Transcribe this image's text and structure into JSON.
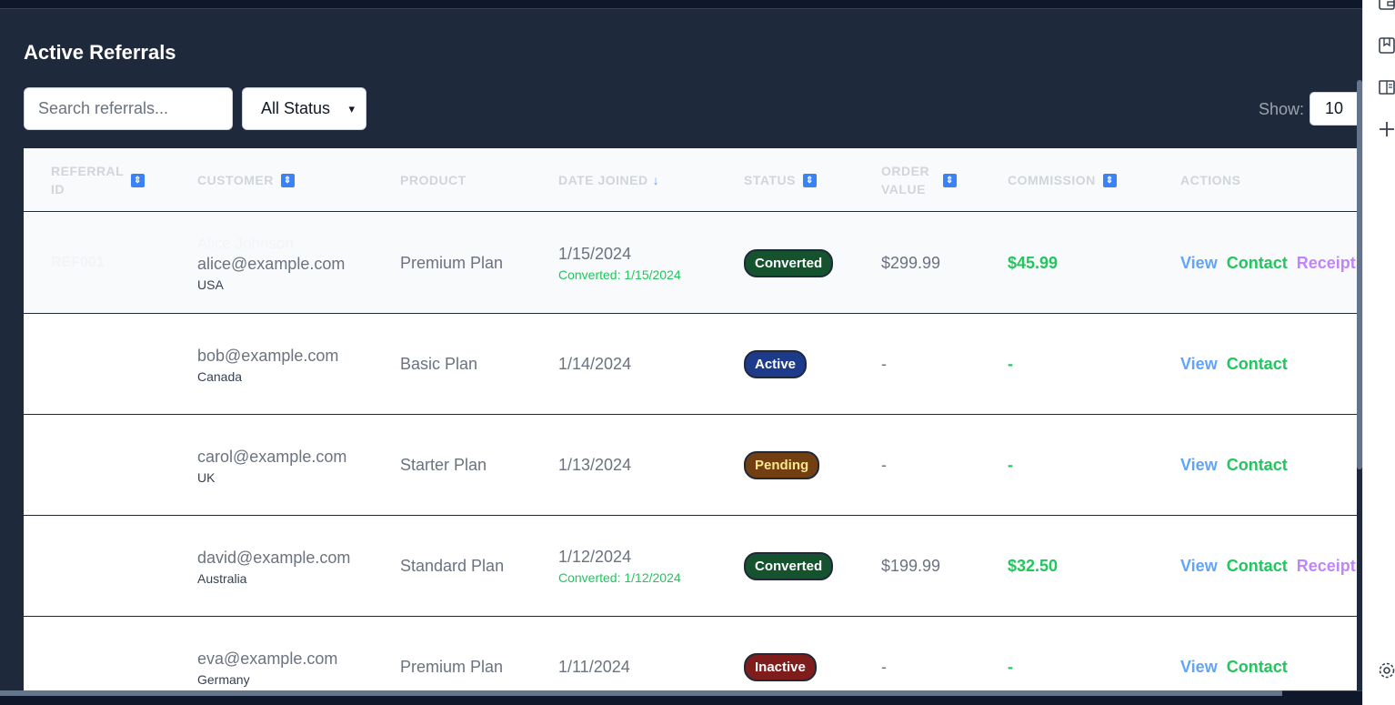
{
  "page": {
    "title": "Active Referrals"
  },
  "controls": {
    "search_placeholder": "Search referrals...",
    "status_filter": "All Status",
    "show_label": "Show:",
    "show_value": "10"
  },
  "table": {
    "headers": {
      "referral_id": "Referral ID",
      "customer": "Customer",
      "product": "Product",
      "date_joined": "Date Joined",
      "status": "Status",
      "order_value": "Order Value",
      "commission": "Commission",
      "actions": "Actions"
    },
    "date_sort_arrow": "↓",
    "rows": [
      {
        "ref_id": "REF001",
        "name": "Alice Johnson",
        "email": "alice@example.com",
        "country": "USA",
        "product": "Premium Plan",
        "date": "1/15/2024",
        "converted": "Converted: 1/15/2024",
        "status": "Converted",
        "order_value": "$299.99",
        "commission": "$45.99",
        "view": "View",
        "contact": "Contact",
        "receipt": "Receipt"
      },
      {
        "ref_id": "",
        "name": "",
        "email": "bob@example.com",
        "country": "Canada",
        "product": "Basic Plan",
        "date": "1/14/2024",
        "converted": "",
        "status": "Active",
        "order_value": "-",
        "commission": "-",
        "view": "View",
        "contact": "Contact",
        "receipt": ""
      },
      {
        "ref_id": "",
        "name": "",
        "email": "carol@example.com",
        "country": "UK",
        "product": "Starter Plan",
        "date": "1/13/2024",
        "converted": "",
        "status": "Pending",
        "order_value": "-",
        "commission": "-",
        "view": "View",
        "contact": "Contact",
        "receipt": ""
      },
      {
        "ref_id": "",
        "name": "",
        "email": "david@example.com",
        "country": "Australia",
        "product": "Standard Plan",
        "date": "1/12/2024",
        "converted": "Converted: 1/12/2024",
        "status": "Converted",
        "order_value": "$199.99",
        "commission": "$32.50",
        "view": "View",
        "contact": "Contact",
        "receipt": "Receipt"
      },
      {
        "ref_id": "",
        "name": "",
        "email": "eva@example.com",
        "country": "Germany",
        "product": "Premium Plan",
        "date": "1/11/2024",
        "converted": "",
        "status": "Inactive",
        "order_value": "-",
        "commission": "-",
        "view": "View",
        "contact": "Contact",
        "receipt": ""
      }
    ]
  },
  "sidebar_icons": [
    "wallet-icon",
    "bookmark-icon",
    "reading-list-icon",
    "add-icon",
    "settings-icon"
  ],
  "colors": {
    "panel_bg": "#1e293b",
    "view_link": "#60a5fa",
    "contact_link": "#22c55e",
    "receipt_link": "#c084fc"
  }
}
